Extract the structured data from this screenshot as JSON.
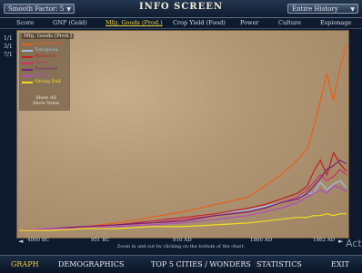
{
  "header": {
    "left_dropdown": "Smooth Factor: 5",
    "title": "INFO SCREEN",
    "right_dropdown": "Entire History"
  },
  "subnav": [
    "Score",
    "GNP (Gold)",
    "Mfg. Goods (Prod.)",
    "Crop Yield (Food)",
    "Power",
    "Culture",
    "Espionage"
  ],
  "side_numbers": [
    "1/1",
    "3/1",
    "7/1"
  ],
  "legend": {
    "title": "Mfg. Goods (Prod.)",
    "items": [
      {
        "name": "Hatshepsut",
        "color": "#e8601c"
      },
      {
        "name": "Tokugawa",
        "color": "#9fc2e8"
      },
      {
        "name": "Bismarck",
        "color": "#c02020"
      },
      {
        "name": "Cyrus",
        "color": "#d02e6a"
      },
      {
        "name": "Ramesses",
        "color": "#7a1f7a"
      },
      {
        "name": "Mansa",
        "color": "#b04cc0"
      },
      {
        "name": "Sitting Bull",
        "color": "#f0e020"
      }
    ],
    "show_all": "Show All",
    "show_none": "Show None"
  },
  "chart_data": {
    "type": "line",
    "title": "Mfg. Goods (Prod.)",
    "x_ticks": [
      "4000 BC",
      "951 BC",
      "910 AD",
      "1800 AD",
      "1862 AD"
    ],
    "x": [
      0,
      10,
      20,
      30,
      40,
      50,
      60,
      70,
      75,
      80,
      85,
      88,
      90,
      92,
      94,
      96,
      98,
      100
    ],
    "series": [
      {
        "name": "Hatshepsut",
        "values": [
          0,
          1,
          2,
          4,
          7,
          10,
          14,
          18,
          24,
          30,
          38,
          44,
          56,
          70,
          85,
          70,
          88,
          100
        ]
      },
      {
        "name": "Tokugawa",
        "values": [
          0,
          1,
          2,
          3,
          5,
          7,
          9,
          11,
          13,
          15,
          18,
          20,
          20,
          26,
          22,
          25,
          27,
          23
        ]
      },
      {
        "name": "Bismarck",
        "values": [
          0,
          1,
          2,
          3,
          5,
          7,
          9,
          12,
          14,
          17,
          20,
          24,
          32,
          38,
          30,
          42,
          36,
          32
        ]
      },
      {
        "name": "Cyrus",
        "values": [
          0,
          1,
          2,
          3,
          4,
          6,
          8,
          10,
          12,
          15,
          18,
          22,
          26,
          30,
          27,
          29,
          33,
          30
        ]
      },
      {
        "name": "Ramesses",
        "values": [
          0,
          1,
          2,
          3,
          4,
          5,
          8,
          10,
          12,
          15,
          17,
          20,
          24,
          28,
          33,
          35,
          38,
          36
        ]
      },
      {
        "name": "Mansa",
        "values": [
          0,
          1,
          1,
          2,
          3,
          4,
          6,
          8,
          10,
          12,
          15,
          18,
          20,
          22,
          20,
          24,
          23,
          21
        ]
      },
      {
        "name": "Sitting Bull",
        "values": [
          0,
          0,
          1,
          1,
          2,
          2,
          3,
          4,
          5,
          6,
          7,
          7,
          8,
          8,
          9,
          8,
          9,
          9
        ]
      }
    ],
    "ylim": [
      0,
      105
    ]
  },
  "zoom_hint": "Zoom in and out by clicking on the bottom of the chart.",
  "bottom_tabs": [
    "GRAPH",
    "DEMOGRAPHICS",
    "TOP 5 CITIES / WONDERS",
    "STATISTICS",
    "EXIT"
  ],
  "watermark": "Act"
}
